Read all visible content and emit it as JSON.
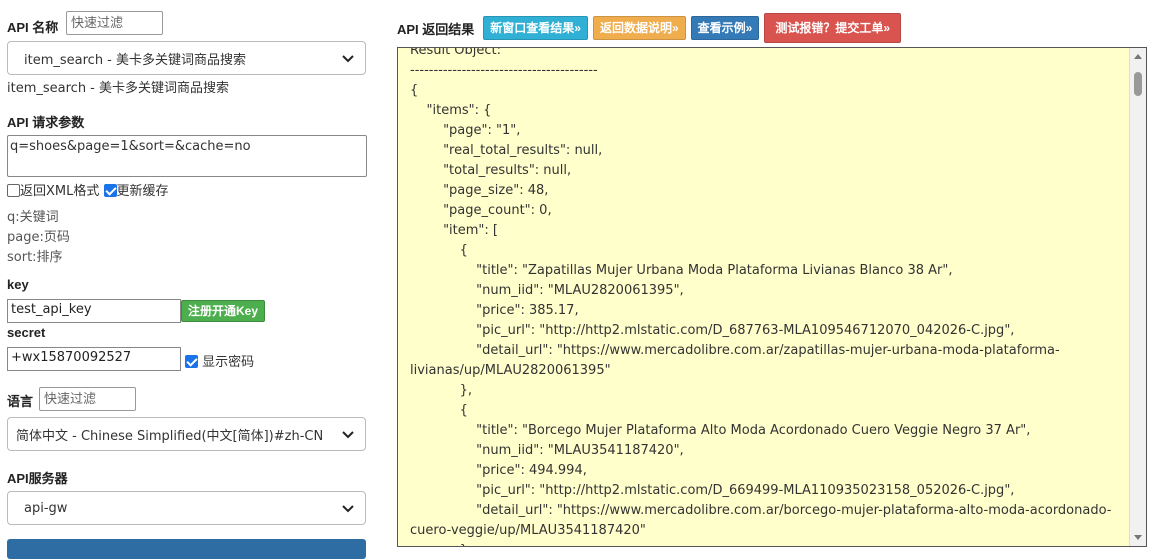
{
  "left": {
    "api_name_label": "API 名称",
    "api_filter_placeholder": "快速过滤",
    "api_select_value": "item_search - 美卡多关键词商品搜索",
    "api_selected_text": "item_search - 美卡多关键词商品搜索",
    "params_label": "API 请求参数",
    "params_value": "q=shoes&page=1&sort=&cache=no",
    "xml_label": "返回XML格式",
    "cache_label": "更新缓存",
    "hints": [
      "q:关键词",
      "page:页码",
      "sort:排序"
    ],
    "key_label": "key",
    "key_value": "test_api_key",
    "register_button": "注册开通Key",
    "secret_label": "secret",
    "secret_value": "+wx15870092527",
    "show_password_label": "显示密码",
    "lang_label": "语言",
    "lang_filter_placeholder": "快速过滤",
    "lang_select_value": "简体中文 - Chinese Simplified(中文[简体])#zh-CN",
    "server_label": "API服务器",
    "server_select_value": "api-gw"
  },
  "right": {
    "title": "API 返回结果",
    "buttons": {
      "new_window": "新窗口查看结果»",
      "return_desc": "返回数据说明»",
      "example": "查看示例»",
      "report": "测试报错？提交工单»"
    }
  },
  "result_text": "Result Object:\n----------------------------------------\n{\n\t\"items\": {\n\t\t\"page\": \"1\",\n\t\t\"real_total_results\": null,\n\t\t\"total_results\": null,\n\t\t\"page_size\": 48,\n\t\t\"page_count\": 0,\n\t\t\"item\": [\n\t\t\t{\n\t\t\t\t\"title\": \"Zapatillas Mujer Urbana Moda Plataforma Livianas Blanco 38 Ar\",\n\t\t\t\t\"num_iid\": \"MLAU2820061395\",\n\t\t\t\t\"price\": 385.17,\n\t\t\t\t\"pic_url\": \"http://http2.mlstatic.com/D_687763-MLA109546712070_042026-C.jpg\",\n\t\t\t\t\"detail_url\": \"https://www.mercadolibre.com.ar/zapatillas-mujer-urbana-moda-plataforma-livianas/up/MLAU2820061395\"\n\t\t\t},\n\t\t\t{\n\t\t\t\t\"title\": \"Borcego Mujer Plataforma Alto Moda Acordonado Cuero Veggie Negro 37 Ar\",\n\t\t\t\t\"num_iid\": \"MLAU3541187420\",\n\t\t\t\t\"price\": 494.994,\n\t\t\t\t\"pic_url\": \"http://http2.mlstatic.com/D_669499-MLA110935023158_052026-C.jpg\",\n\t\t\t\t\"detail_url\": \"https://www.mercadolibre.com.ar/borcego-mujer-plataforma-alto-moda-acordonado-cuero-veggie/up/MLAU3541187420\"\n\t\t\t},\n\t\t\t{"
}
